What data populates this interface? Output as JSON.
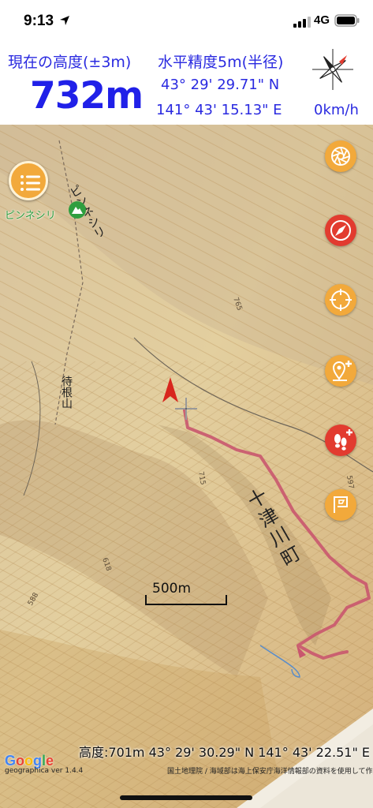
{
  "status_bar": {
    "time": "9:13",
    "network": "4G"
  },
  "header": {
    "altitude_label": "現在の高度(±3m)",
    "altitude_value": "732m",
    "accuracy_label": "水平精度5m(半径)",
    "latitude": "43° 29' 29.71\" N",
    "longitude": "141° 43' 15.13\" E",
    "speed": "0km/h"
  },
  "map": {
    "peak_name": "ピンネシリ",
    "map_labels": {
      "peak_vertical": "ピンネシリ",
      "mountain_vertical": "待根山",
      "town_vertical": "十津川町"
    },
    "contour_labels": [
      "765",
      "715",
      "597",
      "618",
      "588"
    ],
    "scale_label": "500m",
    "bottom_info": "高度:701m  43° 29' 30.29\" N 141° 43' 22.51\" E",
    "google_logo": "Google",
    "version": "geographica ver 1.4.4",
    "attribution": "国土地理院 / 海域部は海上保安庁海洋情報部の資料を使用して作成"
  },
  "buttons": {
    "menu": "menu-icon",
    "map_layers": "aperture-icon",
    "compass": "compass-icon",
    "locate": "crosshair-icon",
    "add_marker": "add-pin-icon",
    "track_record": "footprints-icon",
    "route": "flag-icon"
  },
  "colors": {
    "header_text": "#2a2ae0",
    "button_orange": "#f2a93b",
    "button_red": "#e23b2f",
    "track": "#c9566e",
    "peak_green": "#2f9e3f"
  }
}
